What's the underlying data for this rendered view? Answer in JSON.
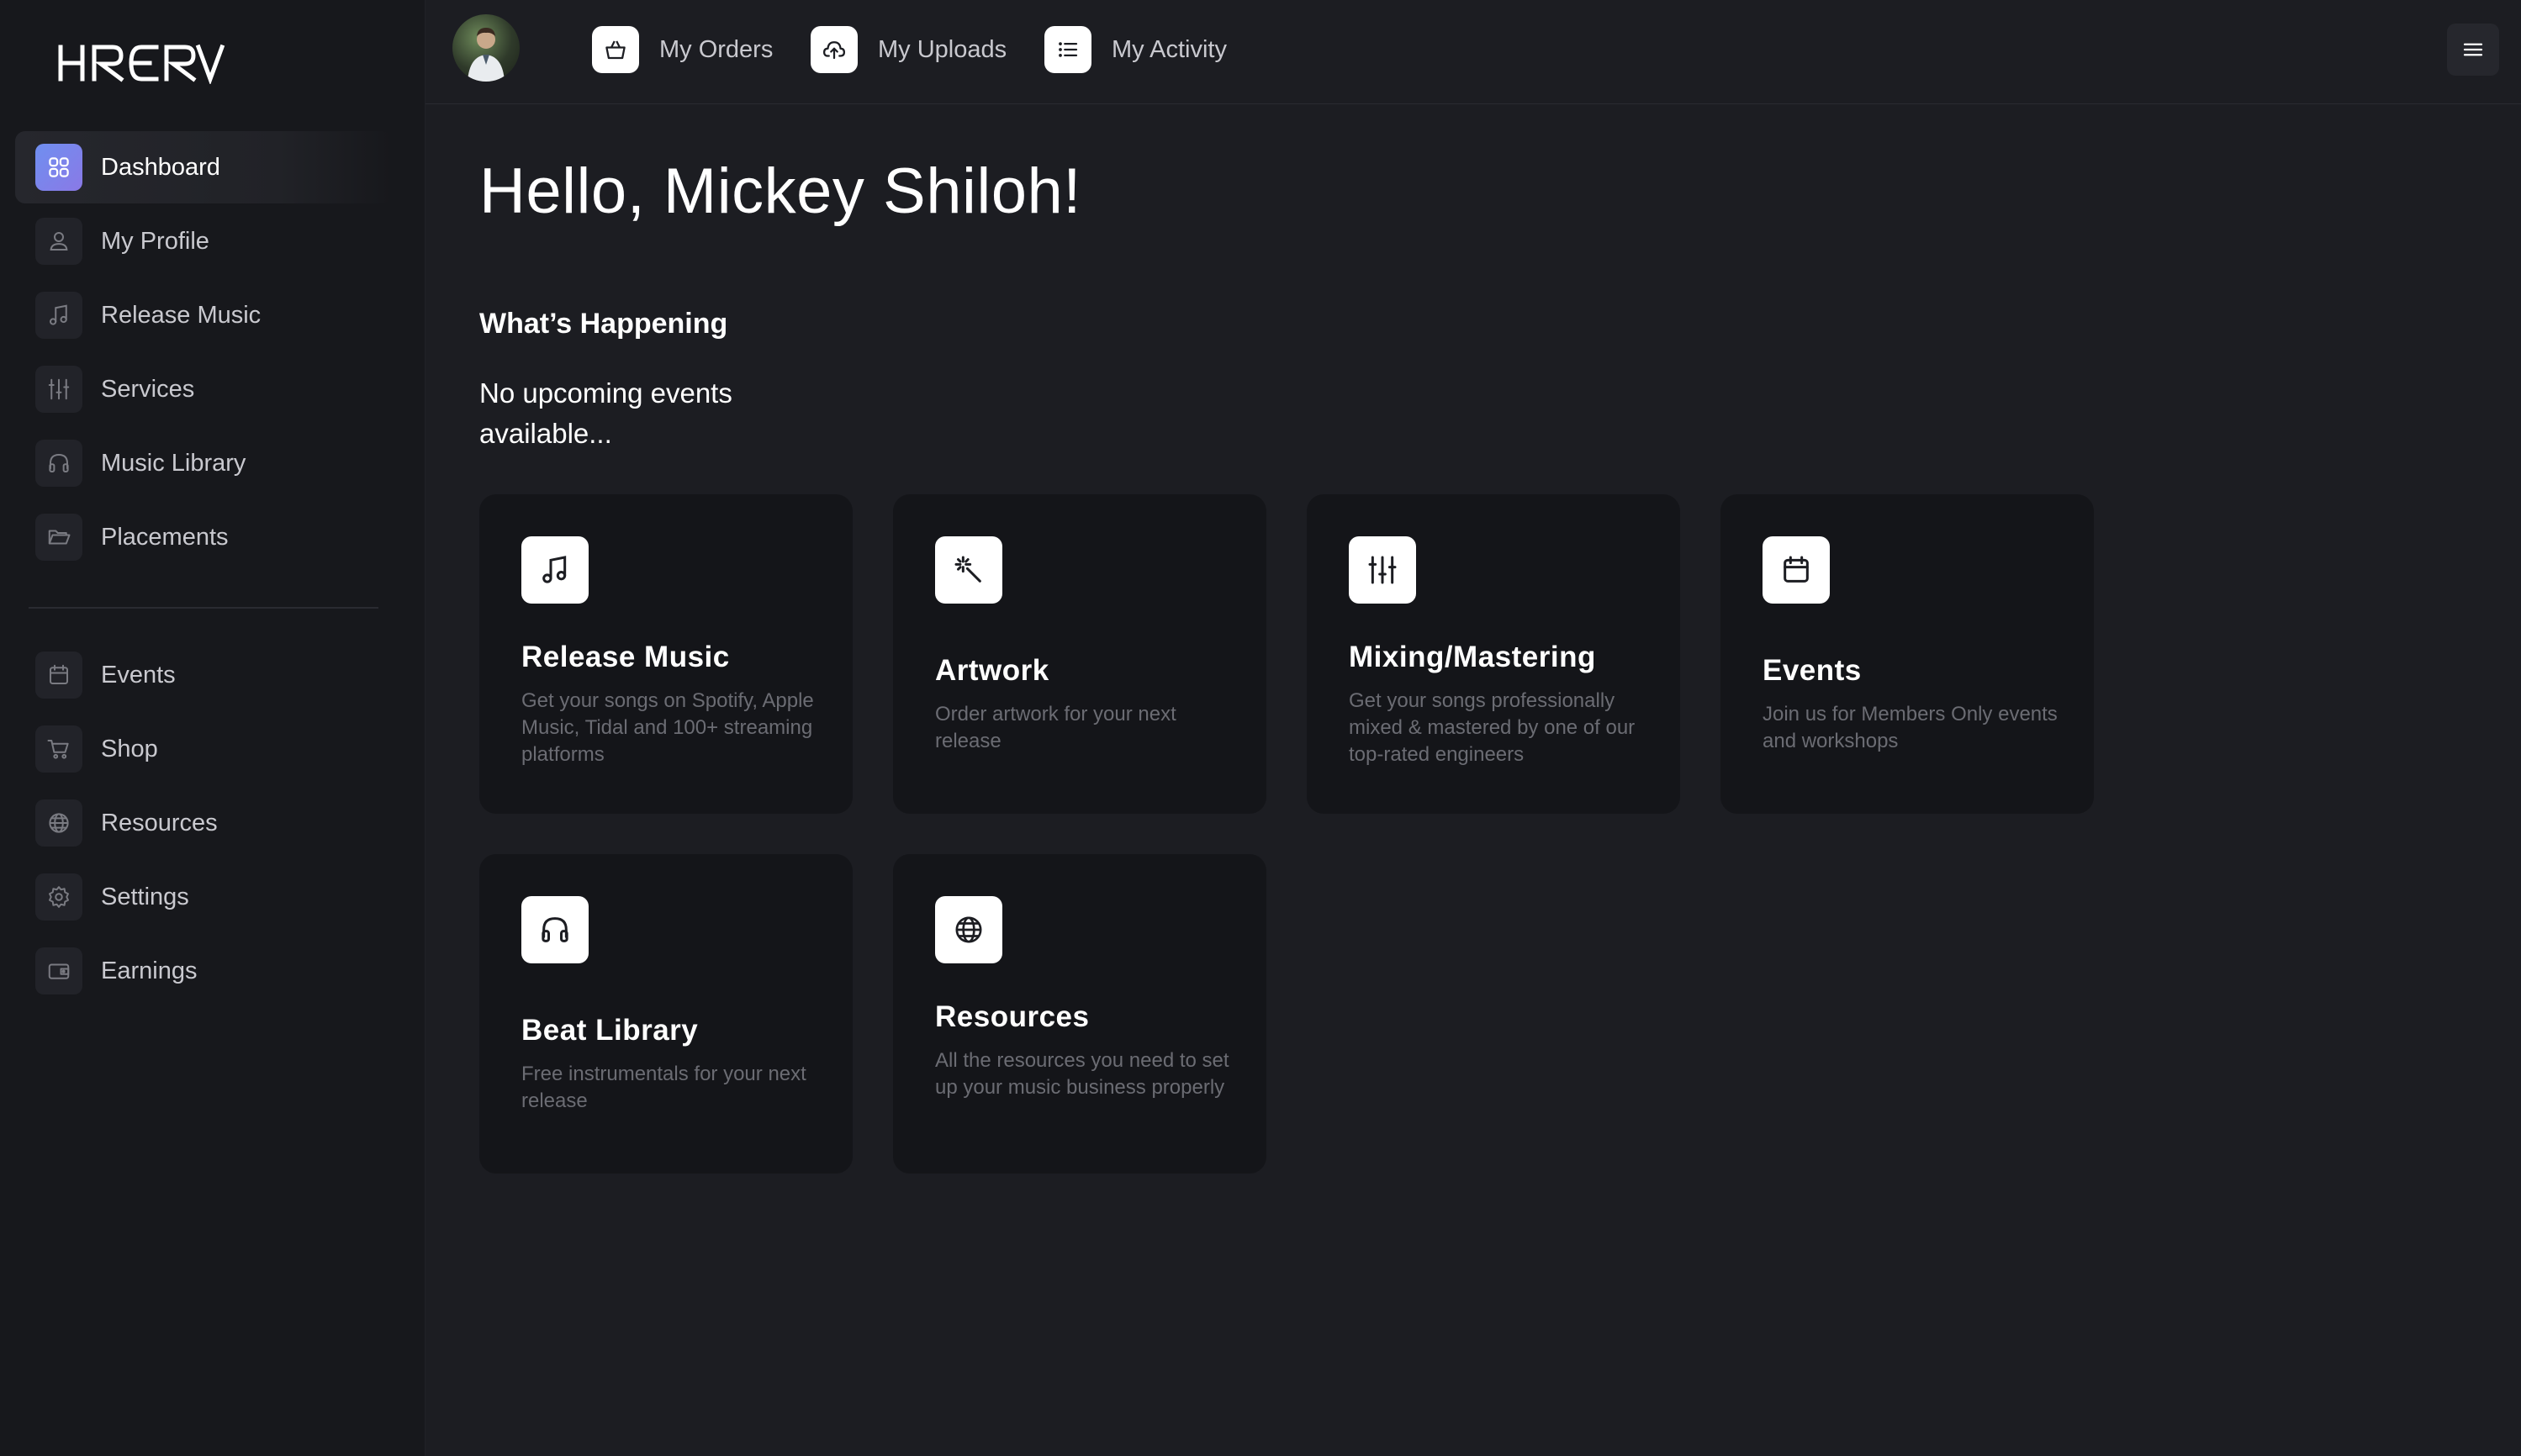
{
  "brand": {
    "logo_text": "HRDRV"
  },
  "colors": {
    "background": "#1c1d22",
    "sidebar": "#17181c",
    "card": "#141519",
    "accent_gradient_start": "#6f8ff0",
    "accent_gradient_end": "#8a79e6",
    "muted_text": "#6b6c73"
  },
  "sidebar": {
    "primary_items": [
      {
        "label": "Dashboard",
        "icon": "dashboard-grid-icon",
        "active": true
      },
      {
        "label": "My Profile",
        "icon": "user-icon",
        "active": false
      },
      {
        "label": "Release Music",
        "icon": "music-note-icon",
        "active": false
      },
      {
        "label": "Services",
        "icon": "sliders-icon",
        "active": false
      },
      {
        "label": "Music Library",
        "icon": "headphones-icon",
        "active": false
      },
      {
        "label": "Placements",
        "icon": "folder-open-icon",
        "active": false
      }
    ],
    "secondary_items": [
      {
        "label": "Events",
        "icon": "calendar-icon"
      },
      {
        "label": "Shop",
        "icon": "cart-icon"
      },
      {
        "label": "Resources",
        "icon": "globe-icon"
      },
      {
        "label": "Settings",
        "icon": "gear-icon"
      },
      {
        "label": "Earnings",
        "icon": "wallet-icon"
      }
    ]
  },
  "topbar": {
    "links": [
      {
        "label": "My Orders",
        "icon": "basket-icon"
      },
      {
        "label": "My Uploads",
        "icon": "cloud-upload-icon"
      },
      {
        "label": "My Activity",
        "icon": "list-icon"
      }
    ],
    "menu_icon": "hamburger-menu-icon"
  },
  "main": {
    "greeting": "Hello, Mickey Shiloh!",
    "section_title": "What’s Happening",
    "no_events": "No upcoming events available...",
    "cards": [
      {
        "title": "Release Music",
        "desc": "Get your songs on Spotify, Apple Music, Tidal and 100+ streaming platforms",
        "icon": "music-note-icon"
      },
      {
        "title": "Artwork",
        "desc": "Order artwork for your next release",
        "icon": "magic-wand-icon"
      },
      {
        "title": "Mixing/Mastering",
        "desc": "Get your songs professionally mixed & mastered by one of our top-rated engineers",
        "icon": "sliders-icon"
      },
      {
        "title": "Events",
        "desc": "Join us for Members Only events and workshops",
        "icon": "calendar-icon"
      },
      {
        "title": "Beat Library",
        "desc": "Free instrumentals for your next release",
        "icon": "headphones-icon"
      },
      {
        "title": "Resources",
        "desc": "All the resources you need to set up your music business properly",
        "icon": "globe-icon"
      }
    ]
  }
}
